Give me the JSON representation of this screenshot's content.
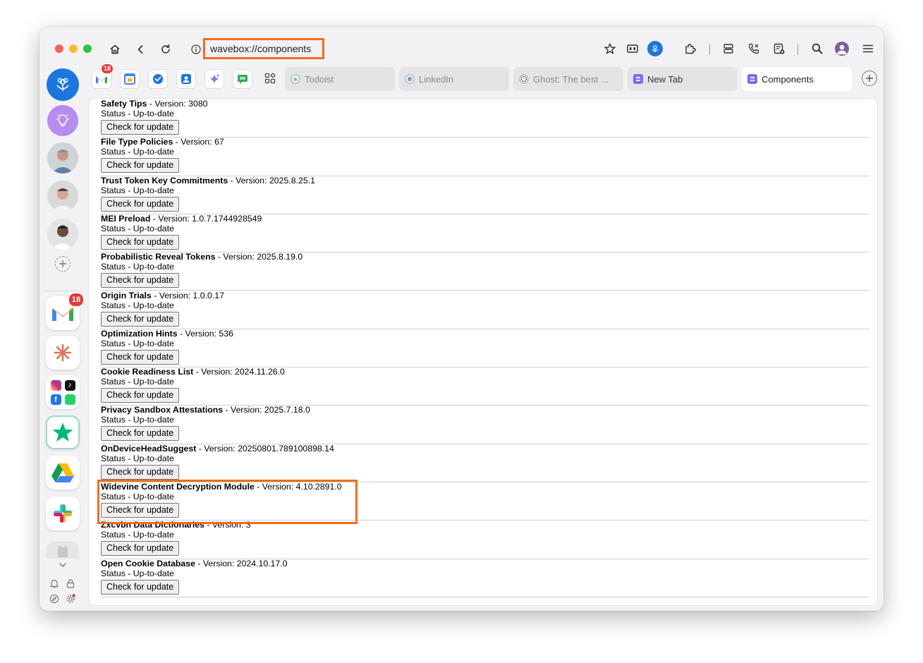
{
  "browser": {
    "url": "wavebox://components",
    "profile_avatar_color": "#7b5ea7"
  },
  "sidebar": {
    "gmail_badge": "18"
  },
  "tabstrip": {
    "gmail_badge": "18",
    "tabs": [
      {
        "label": "Todoist",
        "active": false
      },
      {
        "label": "LinkedIn",
        "active": false
      },
      {
        "label": "Ghost: The best ...",
        "active": false
      },
      {
        "label": "New Tab",
        "active": false
      },
      {
        "label": "Components",
        "active": true
      }
    ]
  },
  "components": [
    {
      "name": "Safety Tips",
      "version": " - Version: 3080",
      "status": "Status - Up-to-date",
      "button": "Check for update"
    },
    {
      "name": "File Type Policies",
      "version": " - Version: 67",
      "status": "Status - Up-to-date",
      "button": "Check for update"
    },
    {
      "name": "Trust Token Key Commitments",
      "version": " - Version: 2025.8.25.1",
      "status": "Status - Up-to-date",
      "button": "Check for update"
    },
    {
      "name": "MEI Preload",
      "version": " - Version: 1.0.7.1744928549",
      "status": "Status - Up-to-date",
      "button": "Check for update"
    },
    {
      "name": "Probabilistic Reveal Tokens",
      "version": " - Version: 2025.8.19.0",
      "status": "Status - Up-to-date",
      "button": "Check for update"
    },
    {
      "name": "Origin Trials",
      "version": " - Version: 1.0.0.17",
      "status": "Status - Up-to-date",
      "button": "Check for update"
    },
    {
      "name": "Optimization Hints",
      "version": " - Version: 536",
      "status": "Status - Up-to-date",
      "button": "Check for update"
    },
    {
      "name": "Cookie Readiness List",
      "version": " - Version: 2024.11.26.0",
      "status": "Status - Up-to-date",
      "button": "Check for update"
    },
    {
      "name": "Privacy Sandbox Attestations",
      "version": " - Version: 2025.7.18.0",
      "status": "Status - Up-to-date",
      "button": "Check for update"
    },
    {
      "name": "OnDeviceHeadSuggest",
      "version": " - Version: 20250801.789100898.14",
      "status": "Status - Up-to-date",
      "button": "Check for update"
    },
    {
      "name": "Widevine Content Decryption Module",
      "version": " - Version: 4.10.2891.0",
      "status": "Status - Up-to-date",
      "button": "Check for update"
    },
    {
      "name": "Zxcvbn Data Dictionaries",
      "version": " - Version: 3",
      "status": "Status - Up-to-date",
      "button": "Check for update"
    },
    {
      "name": "Open Cookie Database",
      "version": " - Version: 2024.10.17.0",
      "status": "Status - Up-to-date",
      "button": "Check for update"
    }
  ],
  "colors": {
    "highlight": "#f26b1d",
    "wavebox_blue": "#1d76e0",
    "badge_red": "#e53935"
  }
}
